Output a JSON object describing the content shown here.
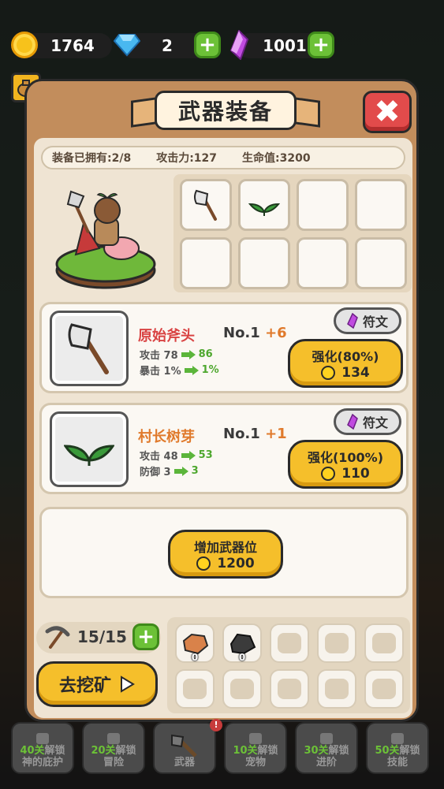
{
  "currency": {
    "gold": "1764",
    "gems": "2",
    "crystals": "1001"
  },
  "panel": {
    "title": "武器装备",
    "stats": {
      "owned": "装备已拥有:2/8",
      "attack": "攻击力:127",
      "hp": "生命值:3200"
    }
  },
  "weapons": [
    {
      "name": "原始斧头",
      "rank": "No.1",
      "level": "+6",
      "stat1_label": "攻击 78",
      "stat1_next": "86",
      "stat2_label": "暴击 1%",
      "stat2_next": "1%",
      "rune_label": "符文",
      "upgrade_label": "强化(80%)",
      "upgrade_cost": "134"
    },
    {
      "name": "村长树芽",
      "rank": "No.1",
      "level": "+1",
      "stat1_label": "攻击 48",
      "stat1_next": "53",
      "stat2_label": "防御 3",
      "stat2_next": "3",
      "rune_label": "符文",
      "upgrade_label": "强化(100%)",
      "upgrade_cost": "110"
    }
  ],
  "add_slot": {
    "label": "增加武器位",
    "cost": "1200"
  },
  "mining": {
    "pickaxes": "15/15",
    "mine_button": "去挖矿",
    "ores": [
      {
        "name": "copper-ore",
        "count": "0"
      },
      {
        "name": "coal-ore",
        "count": "0"
      }
    ]
  },
  "nav": [
    {
      "lvl": "40关",
      "text1": "解锁",
      "text2": "神的庇护"
    },
    {
      "lvl": "20关",
      "text1": "解锁",
      "text2": "冒险"
    },
    {
      "lvl": "",
      "text1": "",
      "text2": "武器"
    },
    {
      "lvl": "10关",
      "text1": "解锁",
      "text2": "宠物"
    },
    {
      "lvl": "30关",
      "text1": "解锁",
      "text2": "进阶"
    },
    {
      "lvl": "50关",
      "text1": "解锁",
      "text2": "技能"
    }
  ],
  "colors": {
    "accent_gold": "#f5bf2b",
    "name_red": "#d94343",
    "name_orange": "#e07a2c",
    "positive_green": "#4ea72e"
  }
}
